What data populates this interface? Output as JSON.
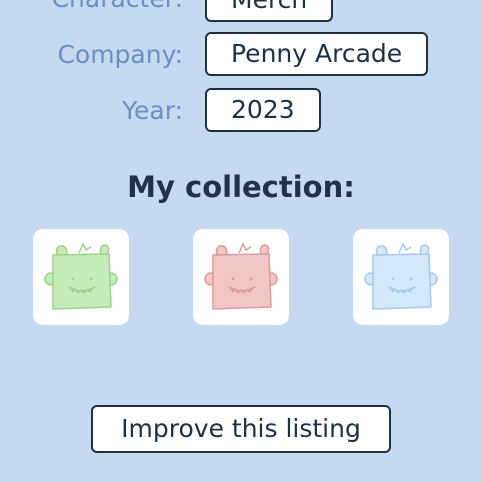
{
  "details": {
    "character": {
      "label": "Character:",
      "value": "Merch"
    },
    "company": {
      "label": "Company:",
      "value": "Penny Arcade"
    },
    "year": {
      "label": "Year:",
      "value": "2023"
    }
  },
  "collection": {
    "title": "My collection:",
    "items": [
      {
        "icon": "green-monster-icon",
        "fill": "#c4ecb8",
        "stroke": "#9fd08e"
      },
      {
        "icon": "red-monster-icon",
        "fill": "#f3c6c6",
        "stroke": "#d99b9b"
      },
      {
        "icon": "blue-monster-icon",
        "fill": "#d3e8fb",
        "stroke": "#a9c9ea"
      }
    ]
  },
  "actions": {
    "improve_label": "Improve this listing"
  },
  "colors": {
    "background": "#c5d9f1",
    "label": "#6b8fc5",
    "text": "#1f2f44"
  }
}
